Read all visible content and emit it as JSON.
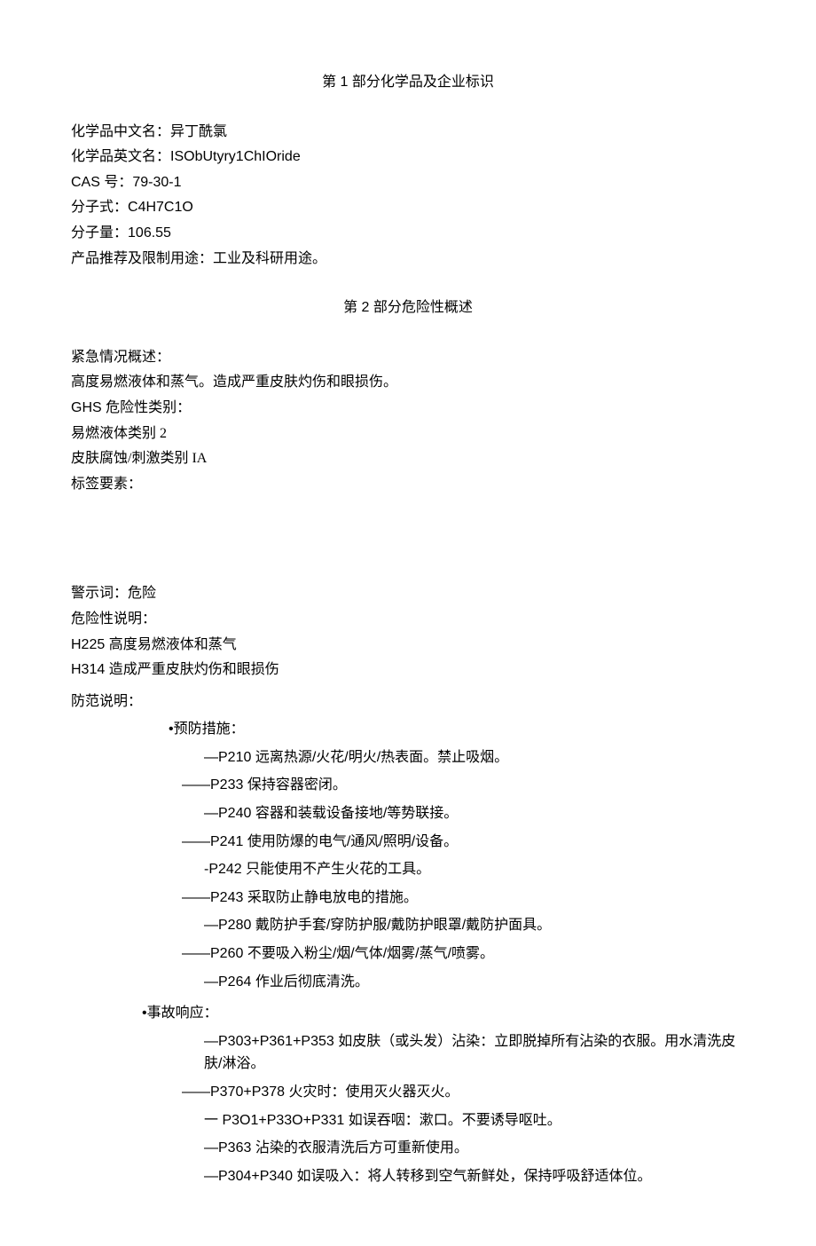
{
  "section1": {
    "title": "第 1 部分化学品及企业标识",
    "cn_name_label": "化学品中文名：",
    "cn_name": "异丁酰氯",
    "en_name_label": "化学品英文名：",
    "en_name": "ISObUtyry1ChIOride",
    "cas_label": "CAS 号：",
    "cas": "79-30-1",
    "formula_label": "分子式：",
    "formula": "C4H7C1O",
    "mw_label": "分子量：",
    "mw": "106.55",
    "usage_label": "产品推荐及限制用途：",
    "usage": "工业及科研用途。"
  },
  "section2": {
    "title": "第 2 部分危险性概述",
    "emergency_label": "紧急情况概述：",
    "emergency_text": "高度易燃液体和蒸气。造成严重皮肤灼伤和眼损伤。",
    "ghs_label": "GHS 危险性类别：",
    "ghs_1": "易燃液体类别 2",
    "ghs_2": "皮肤腐蚀/刺激类别 IA",
    "label_elements": "标签要素：",
    "signal_label": "警示词：",
    "signal_word": "危险",
    "hazard_label": "危险性说明：",
    "h225": "H225 高度易燃液体和蒸气",
    "h314": "H314 造成严重皮肤灼伤和眼损伤",
    "precaution_label": "防范说明：",
    "prevention_title": "•预防措施：",
    "p210": "—P210 远离热源/火花/明火/热表面。禁止吸烟。",
    "p233": "——P233 保持容器密闭。",
    "p240": "—P240 容器和装载设备接地/等势联接。",
    "p241": "——P241 使用防爆的电气/通风/照明/设备。",
    "p242": "-P242 只能使用不产生火花的工具。",
    "p243": "——P243 采取防止静电放电的措施。",
    "p280": "—P280 戴防护手套/穿防护服/戴防护眼罩/戴防护面具。",
    "p260": "——P260 不要吸入粉尘/烟/气体/烟雾/蒸气/喷雾。",
    "p264": "—P264 作业后彻底清洗。",
    "response_title": "•事故响应：",
    "p303": "—P303+P361+P353 如皮肤（或头发）沾染：立即脱掉所有沾染的衣服。用水清洗皮肤/淋浴。",
    "p370": "——P370+P378 火灾时：使用灭火器灭火。",
    "p301": "一 P3O1+P33O+P331 如误吞咽：漱口。不要诱导呕吐。",
    "p363": "—P363 沾染的衣服清洗后方可重新使用。",
    "p304": "—P304+P340 如误吸入：将人转移到空气新鲜处，保持呼吸舒适体位。"
  }
}
